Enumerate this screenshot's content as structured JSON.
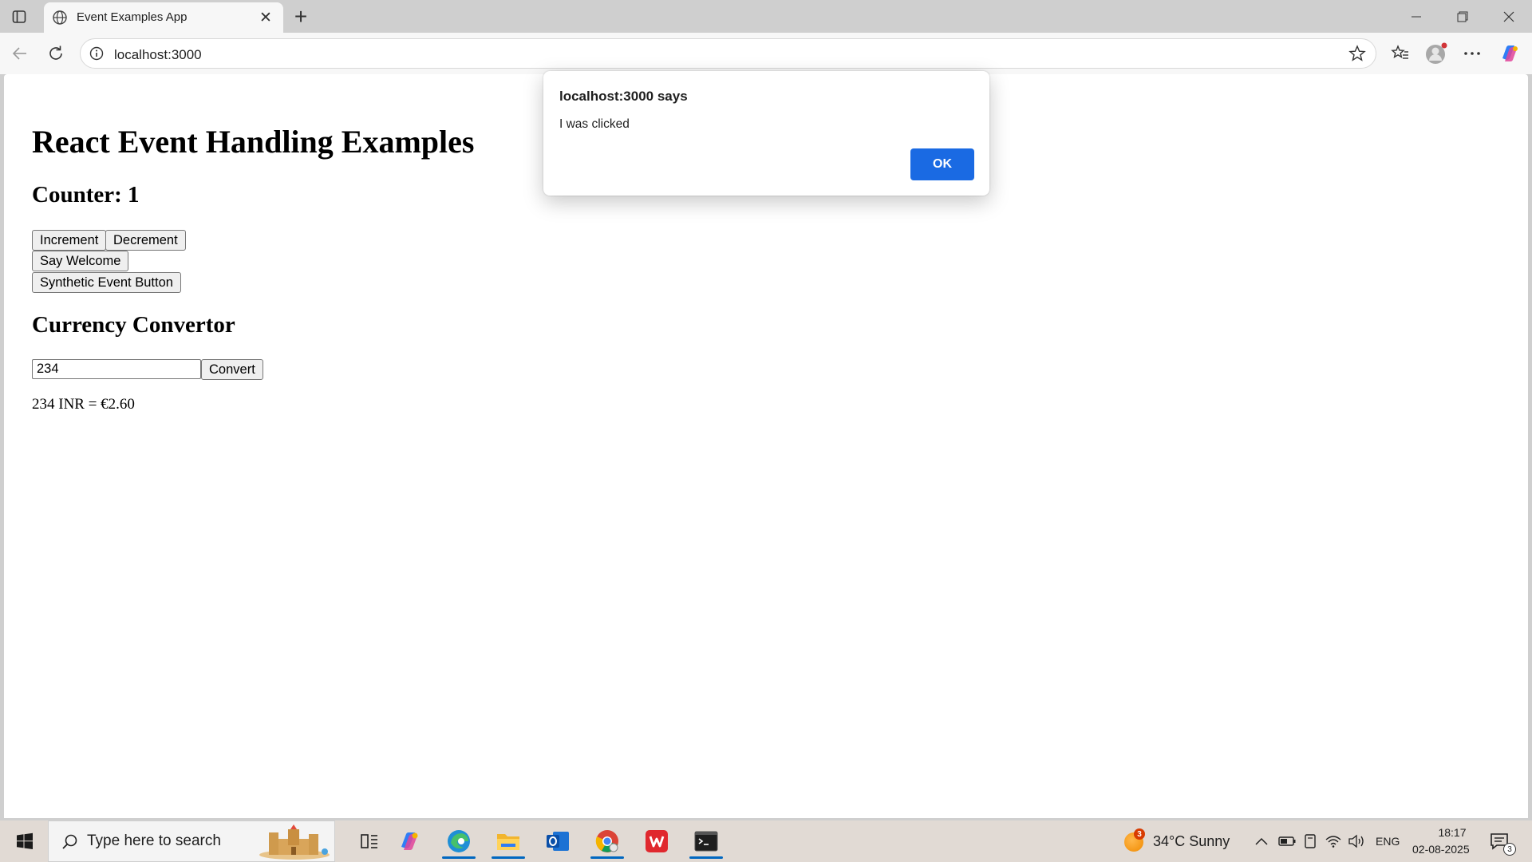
{
  "browser": {
    "tab_title": "Event Examples App",
    "url": "localhost:3000"
  },
  "page": {
    "heading": "React Event Handling Examples",
    "counter_heading": "Counter: 1",
    "buttons": {
      "increment": "Increment",
      "decrement": "Decrement",
      "say_welcome": "Say Welcome",
      "synthetic": "Synthetic Event Button"
    },
    "currency": {
      "heading": "Currency Convertor",
      "amount_value": "234",
      "convert_label": "Convert",
      "result": "234 INR = €2.60"
    }
  },
  "dialog": {
    "title": "localhost:3000 says",
    "message": "I was clicked",
    "ok_label": "OK",
    "ok_color": "#1a6ae3"
  },
  "taskbar": {
    "search_placeholder": "Type here to search",
    "weather_badge": "3",
    "weather": "34°C  Sunny",
    "language": "ENG",
    "time": "18:17",
    "date": "02-08-2025",
    "notification_count": "3",
    "apps": [
      "copilot-icon",
      "edge-icon",
      "file-explorer-icon",
      "outlook-icon",
      "chrome-icon",
      "wps-office-icon",
      "terminal-icon"
    ]
  }
}
